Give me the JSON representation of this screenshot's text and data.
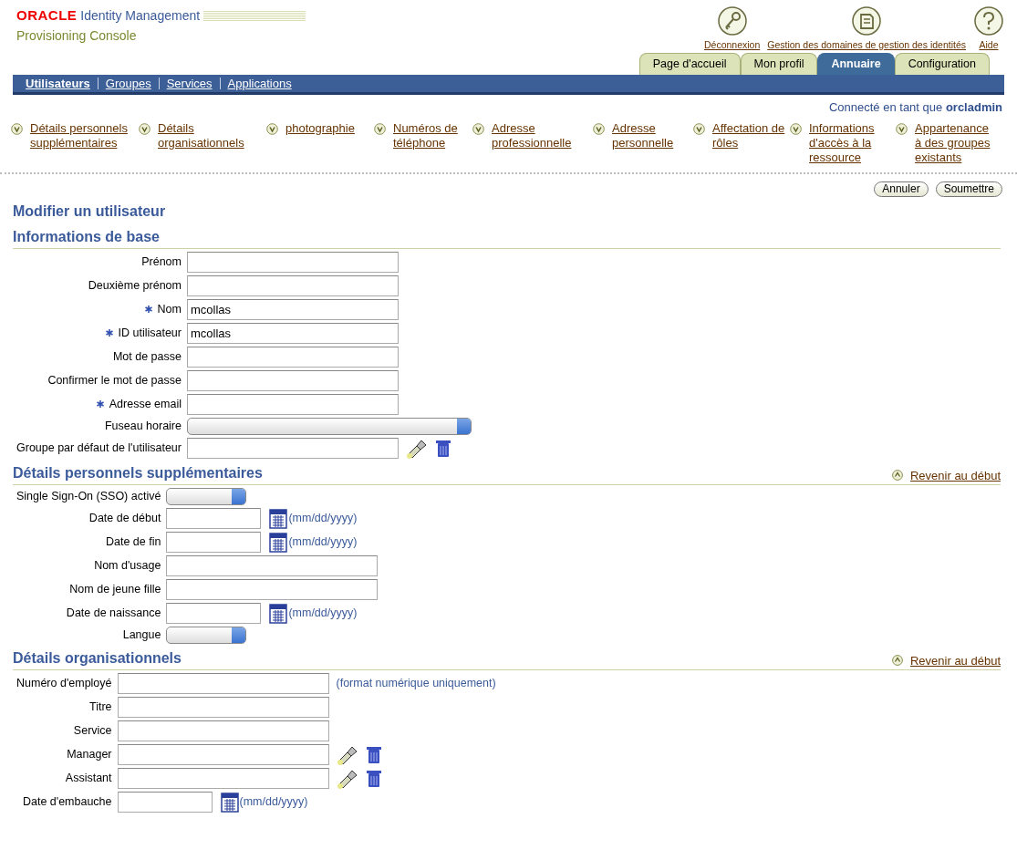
{
  "branding": {
    "company": "ORACLE",
    "product": "Identity Management",
    "console": "Provisioning Console"
  },
  "global_links": [
    {
      "label": "Déconnexion",
      "kind": "key"
    },
    {
      "label": "Gestion des domaines de gestion des identités",
      "kind": "book"
    },
    {
      "label": "Aide",
      "kind": "help"
    }
  ],
  "tabs": [
    {
      "label": "Page d'accueil",
      "selected": false
    },
    {
      "label": "Mon profil",
      "selected": false
    },
    {
      "label": "Annuaire",
      "selected": true
    },
    {
      "label": "Configuration",
      "selected": false
    }
  ],
  "subtabs": [
    {
      "label": "Utilisateurs",
      "selected": true
    },
    {
      "label": "Groupes",
      "selected": false
    },
    {
      "label": "Services",
      "selected": false
    },
    {
      "label": "Applications",
      "selected": false
    }
  ],
  "logged_in": "Connecté en tant que **orcladmin**",
  "quick_links": [
    "Détails personnels supplémentaires",
    "Détails organisationnels",
    "photographie",
    "Numéros de téléphone",
    "Adresse professionnelle",
    "Adresse personnelle",
    "Affectation de rôles",
    "Informations d'accès à la ressource",
    "Appartenance à des groupes existants"
  ],
  "buttons": [
    "Annuler",
    "Soumettre"
  ],
  "page_title": "Modifier un utilisateur",
  "sections": [
    {
      "title": "Informations de base",
      "fields": [
        {
          "label": "Prénom",
          "required": false,
          "kind": "text"
        },
        {
          "label": "Deuxième prénom",
          "required": false,
          "kind": "text"
        },
        {
          "label": "Nom",
          "required": true,
          "kind": "text",
          "value": "mcollas"
        },
        {
          "label": "ID utilisateur",
          "required": true,
          "kind": "text",
          "value": "mcollas"
        },
        {
          "label": "Mot de passe",
          "required": false,
          "kind": "text"
        },
        {
          "label": "Confirmer le mot de passe",
          "required": false,
          "kind": "text"
        },
        {
          "label": "Adresse email",
          "required": true,
          "kind": "text"
        },
        {
          "label": "Fuseau horaire",
          "required": false,
          "kind": "select"
        },
        {
          "label": "Groupe par défaut de l'utilisateur",
          "required": false,
          "kind": "lookup"
        }
      ]
    },
    {
      "title": "Détails personnels supplémentaires",
      "back_link": "Revenir au début",
      "fields": [
        {
          "label": "Single Sign-On (SSO) activé",
          "required": false,
          "kind": "select"
        },
        {
          "label": "Date de début",
          "required": false,
          "kind": "date",
          "hint": "(mm/dd/yyyy)"
        },
        {
          "label": "Date de fin",
          "required": false,
          "kind": "date",
          "hint": "(mm/dd/yyyy)"
        },
        {
          "label": "Nom d'usage",
          "required": false,
          "kind": "text"
        },
        {
          "label": "Nom de jeune fille",
          "required": false,
          "kind": "text"
        },
        {
          "label": "Date de naissance",
          "required": false,
          "kind": "date",
          "hint": "(mm/dd/yyyy)"
        },
        {
          "label": "Langue",
          "required": false,
          "kind": "select"
        }
      ]
    },
    {
      "title": "Détails organisationnels",
      "back_link": "Revenir au début",
      "fields": [
        {
          "label": "Numéro d'employé",
          "required": false,
          "kind": "text",
          "hint": "(format numérique uniquement)"
        },
        {
          "label": "Titre",
          "required": false,
          "kind": "text"
        },
        {
          "label": "Service",
          "required": false,
          "kind": "text"
        },
        {
          "label": "Manager",
          "required": false,
          "kind": "lookup"
        },
        {
          "label": "Assistant",
          "required": false,
          "kind": "lookup"
        },
        {
          "label": "Date d'embauche",
          "required": false,
          "kind": "date",
          "hint": "(mm/dd/yyyy)"
        }
      ]
    }
  ]
}
